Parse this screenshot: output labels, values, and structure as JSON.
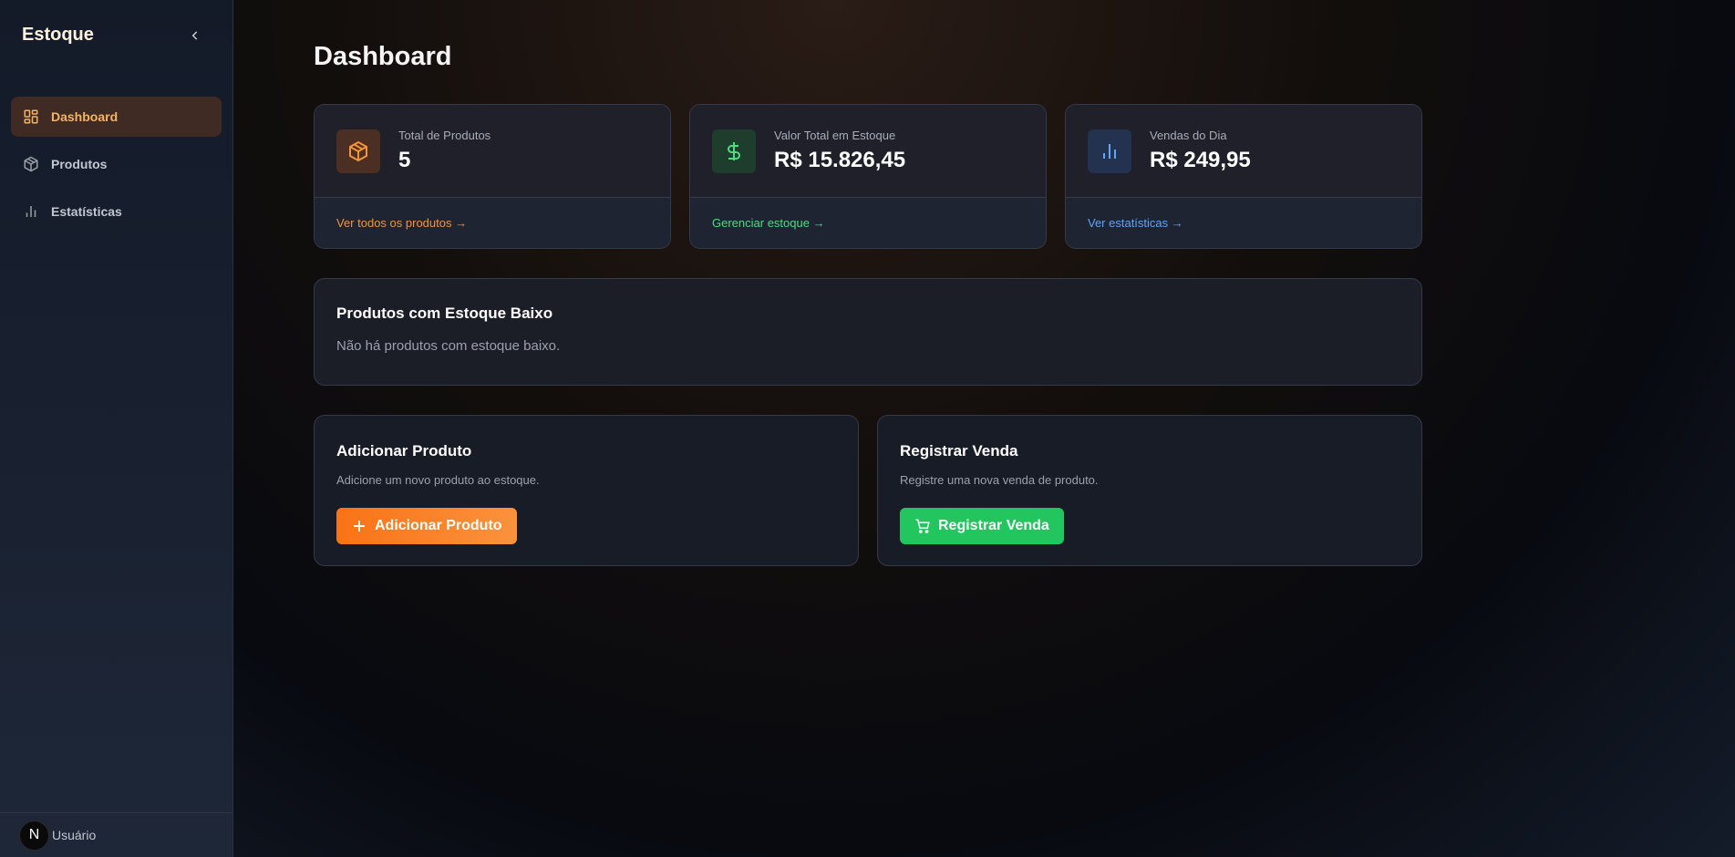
{
  "sidebar": {
    "brand": "Estoque",
    "items": [
      {
        "label": "Dashboard",
        "icon": "layout-dashboard-icon",
        "active": true
      },
      {
        "label": "Produtos",
        "icon": "package-icon"
      },
      {
        "label": "Estatísticas",
        "icon": "bar-chart-icon"
      }
    ],
    "user": {
      "initial": "N",
      "name": "Usuário"
    }
  },
  "main": {
    "title": "Dashboard",
    "stats": [
      {
        "label": "Total de Produtos",
        "value": "5",
        "link": "Ver todos os produtos →",
        "color": "#f7923a",
        "icon": "package-icon"
      },
      {
        "label": "Valor Total em Estoque",
        "value": "R$ 15.826,45",
        "link": "Gerenciar estoque →",
        "color": "#4ade80",
        "icon": "dollar-icon"
      },
      {
        "label": "Vendas do Dia",
        "value": "R$ 249,95",
        "link": "Ver estatísticas →",
        "color": "#60a5fa",
        "icon": "bar-chart-icon"
      }
    ],
    "low_stock": {
      "title": "Produtos com Estoque Baixo",
      "message": "Não há produtos com estoque baixo."
    },
    "actions": [
      {
        "title": "Adicionar Produto",
        "text": "Adicione um novo produto ao estoque.",
        "button": "Adicionar Produto",
        "color": "#f97316"
      },
      {
        "title": "Registrar Venda",
        "text": "Registre uma nova venda de produto.",
        "button": "Registrar Venda",
        "color": "#22c55e"
      }
    ]
  }
}
